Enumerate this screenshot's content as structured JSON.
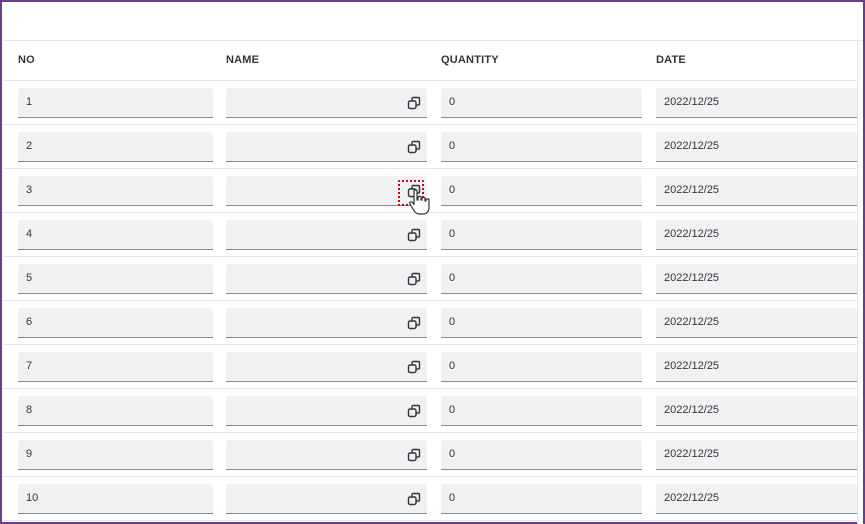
{
  "columns": [
    "NO",
    "NAME",
    "QUANTITY",
    "DATE"
  ],
  "rows": [
    {
      "no": "1",
      "name": "",
      "quantity": "0",
      "date": "2022/12/25"
    },
    {
      "no": "2",
      "name": "",
      "quantity": "0",
      "date": "2022/12/25"
    },
    {
      "no": "3",
      "name": "",
      "quantity": "0",
      "date": "2022/12/25"
    },
    {
      "no": "4",
      "name": "",
      "quantity": "0",
      "date": "2022/12/25"
    },
    {
      "no": "5",
      "name": "",
      "quantity": "0",
      "date": "2022/12/25"
    },
    {
      "no": "6",
      "name": "",
      "quantity": "0",
      "date": "2022/12/25"
    },
    {
      "no": "7",
      "name": "",
      "quantity": "0",
      "date": "2022/12/25"
    },
    {
      "no": "8",
      "name": "",
      "quantity": "0",
      "date": "2022/12/25"
    },
    {
      "no": "9",
      "name": "",
      "quantity": "0",
      "date": "2022/12/25"
    },
    {
      "no": "10",
      "name": "",
      "quantity": "0",
      "date": "2022/12/25"
    }
  ],
  "icons": {
    "name_field_icon": "value-help-icon",
    "pointer": "hand-pointer-cursor-icon"
  },
  "colors": {
    "frame_border": "#6a3d8f",
    "field_background": "#eff1f2",
    "field_underline": "#7a8ea3",
    "highlight_box": "#d0021b"
  },
  "highlighted_row": 4
}
